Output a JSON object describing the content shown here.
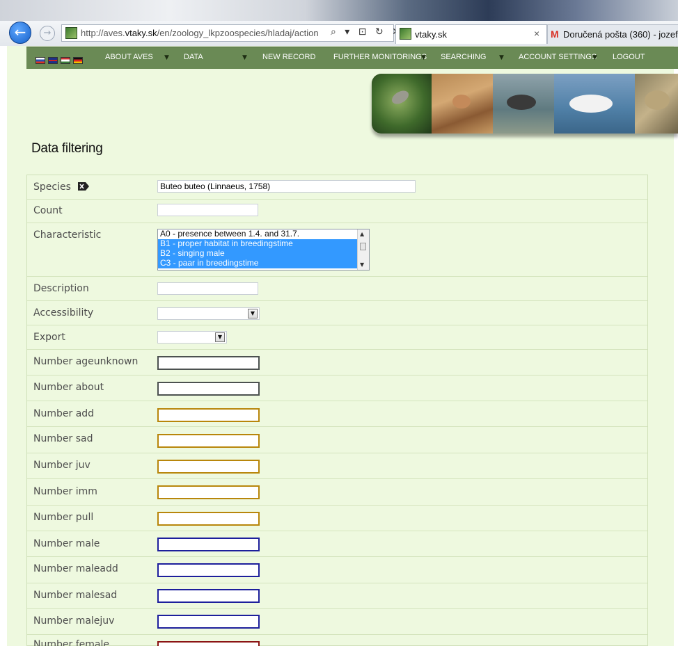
{
  "browser": {
    "url_prefix": "http://aves.",
    "url_domain": "vtaky.sk",
    "url_path": "/en/zoology_lkpzoospecies/hladaj/action",
    "url_toolbar_icons": "⌕ ▾ ⊡ ↻ ✕",
    "tabs": [
      {
        "label": "vtaky.sk",
        "close": "×"
      },
      {
        "label": "Doručená pošta (360) - jozef.",
        "icon": "M"
      }
    ]
  },
  "nav": {
    "items": [
      {
        "label": "ABOUT AVES"
      },
      {
        "label": "DATA"
      },
      {
        "label": "NEW RECORD"
      },
      {
        "label": "FURTHER MONITORINGS"
      },
      {
        "label": "SEARCHING"
      },
      {
        "label": "ACCOUNT SETTINGS"
      },
      {
        "label": "LOGOUT"
      }
    ],
    "arrow": "▼"
  },
  "page": {
    "title": "Data filtering"
  },
  "form": {
    "species": {
      "label": "Species",
      "value": "Buteo buteo (Linnaeus, 1758)"
    },
    "count": {
      "label": "Count",
      "value": ""
    },
    "characteristic": {
      "label": "Characteristic",
      "options": [
        {
          "text": "A0 - presence between 1.4. and 31.7.",
          "selected": false
        },
        {
          "text": "B1 - proper habitat in breedingstime",
          "selected": true
        },
        {
          "text": "B2 - singing male",
          "selected": true
        },
        {
          "text": "C3 - paar in breedingstime",
          "selected": true
        }
      ]
    },
    "description": {
      "label": "Description",
      "value": ""
    },
    "accessibility": {
      "label": "Accessibility",
      "value": ""
    },
    "export": {
      "label": "Export",
      "value": ""
    },
    "numbers": [
      {
        "label": "Number ageunknown",
        "color": "#4c5150"
      },
      {
        "label": "Number about",
        "color": "#4c5150"
      },
      {
        "label": "Number add",
        "color": "#b8860b"
      },
      {
        "label": "Number sad",
        "color": "#b8860b"
      },
      {
        "label": "Number juv",
        "color": "#b8860b"
      },
      {
        "label": "Number imm",
        "color": "#b8860b"
      },
      {
        "label": "Number pull",
        "color": "#b8860b"
      },
      {
        "label": "Number male",
        "color": "#1d1f9c"
      },
      {
        "label": "Number maleadd",
        "color": "#1d1f9c"
      },
      {
        "label": "Number malesad",
        "color": "#1d1f9c"
      },
      {
        "label": "Number malejuv",
        "color": "#1d1f9c"
      },
      {
        "label": "Number female",
        "color": "#8b1414"
      }
    ]
  }
}
